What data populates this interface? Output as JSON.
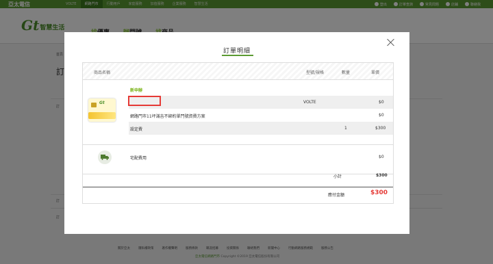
{
  "topbar": {
    "brand": "亞太電信",
    "tabs": [
      "VOLTE",
      "網路門市",
      "行動用戶",
      "家庭服務",
      "加值服務",
      "企業服務",
      "智慧生活"
    ],
    "active_tab": 1,
    "right": [
      "登出",
      "訂單查詢",
      "常見問題",
      "店鋪",
      "聯絡我"
    ]
  },
  "header": {
    "logo_mark": "Gt",
    "logo_text": "智慧生活",
    "nav": [
      {
        "hl": "找",
        "text": "優惠"
      },
      {
        "hl": "辦",
        "text": "門號"
      },
      {
        "hl": "找",
        "text": "商品"
      }
    ]
  },
  "background": {
    "breadcrumb": "首頁",
    "heading": "訂",
    "sub1": "訂",
    "sub2": "訂",
    "sub3": "訂"
  },
  "modal": {
    "title": "訂單明細",
    "columns": {
      "name": "商品名稱",
      "model": "型號/規格",
      "qty": "數量",
      "price": "單價"
    },
    "group_label": "新申辦",
    "rows": [
      {
        "name": "",
        "model": "VOLTE",
        "qty": "",
        "price": "$0"
      },
      {
        "name": "網路門市11坪滿吉不綁約單門號資費方案",
        "model": "",
        "qty": "",
        "price": "$0"
      },
      {
        "name": "設定費",
        "model": "",
        "qty": "1",
        "price": "$300"
      }
    ],
    "shipping": {
      "name": "宅配費用",
      "price": "$0"
    },
    "subtotal_label": "小計",
    "subtotal": "$300",
    "total_label": "應付金額",
    "total": "$300"
  },
  "footer": {
    "links": [
      "關於亞太",
      "隱私權政策",
      "著作權聲明",
      "服務條款",
      "職涯招募",
      "投資關係",
      "聯絡我們",
      "新聞中心",
      "行動網路服務規範",
      "服務公告"
    ],
    "copy_green": "亞太電信網路門市",
    "copy": "Copyright ©2019 亞太電信股份有限公司"
  },
  "colors": {
    "brand_green": "#5b9a32",
    "accent_green": "#7ab317",
    "total_red": "#e53935"
  }
}
